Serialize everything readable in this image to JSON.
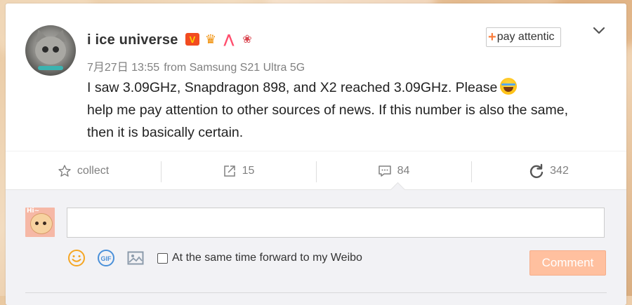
{
  "post": {
    "author": "i ice universe",
    "badges": [
      "v-badge",
      "crown-badge",
      "a-badge",
      "gift-badge"
    ],
    "date": "7月27日 13:55",
    "source": "from Samsung S21 Ultra 5G",
    "follow_label": "pay attentic",
    "text_line1": "I saw 3.09GHz, Snapdragon 898, and X2 reached 3.09GHz. Please",
    "text_line2": "help me pay attention to other sources of news. If this number is also the same,",
    "text_line3": "then it is basically certain."
  },
  "actions": {
    "collect_label": "collect",
    "forward_count": "15",
    "comment_count": "84",
    "like_count": "342"
  },
  "comment_box": {
    "input_value": "",
    "forward_label": "At the same time forward to my Weibo",
    "submit_label": "Comment"
  },
  "colors": {
    "accent": "#fa7d3c",
    "comment_button": "#ffc09f",
    "text_primary": "#333333",
    "text_muted": "#808080"
  },
  "icons": {
    "emoji": "smiley-icon",
    "gif": "gif-icon",
    "image": "image-icon",
    "collect": "star-icon",
    "forward": "forward-icon",
    "comment": "comment-icon",
    "like": "refresh-like-icon"
  }
}
